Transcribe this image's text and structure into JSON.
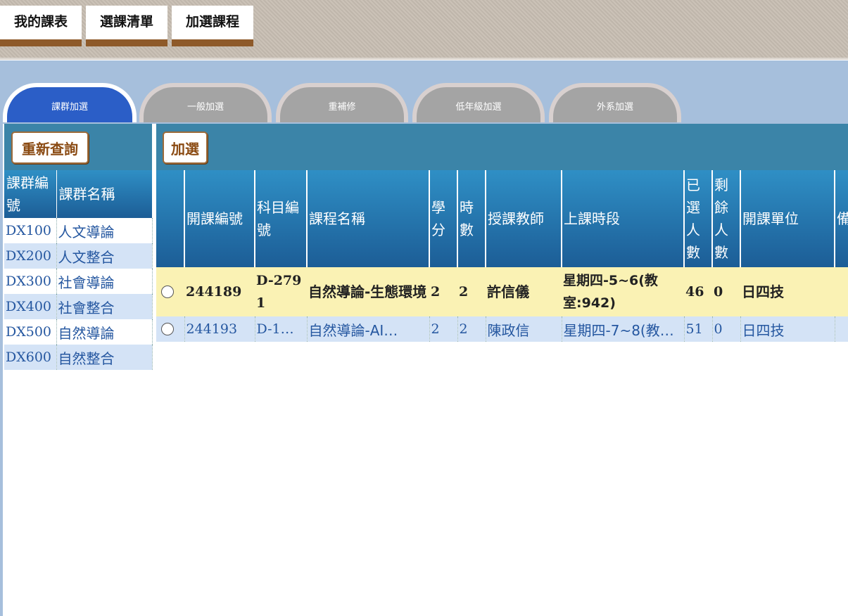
{
  "top_nav": {
    "my_schedule": "我的課表",
    "course_list": "選課清單",
    "add_course": "加選課程"
  },
  "tabs": [
    {
      "label": "課群加選",
      "active": true
    },
    {
      "label": "一般加選",
      "active": false
    },
    {
      "label": "重補修",
      "active": false
    },
    {
      "label": "低年級加選",
      "active": false
    },
    {
      "label": "外系加選",
      "active": false
    }
  ],
  "left_panel": {
    "requery_button": "重新查詢",
    "headers": {
      "group_id": "課群編號",
      "group_name": "課群名稱"
    },
    "groups": [
      {
        "id": "DX100",
        "name": "人文導論"
      },
      {
        "id": "DX200",
        "name": "人文整合"
      },
      {
        "id": "DX300",
        "name": "社會導論"
      },
      {
        "id": "DX400",
        "name": "社會整合"
      },
      {
        "id": "DX500",
        "name": "自然導論"
      },
      {
        "id": "DX600",
        "name": "自然整合"
      }
    ]
  },
  "main_panel": {
    "add_button": "加選",
    "headers": {
      "course_no": "開課編號",
      "subject_no": "科目編號",
      "course_name": "課程名稱",
      "credits": "學分",
      "hours": "時數",
      "teacher": "授課教師",
      "time": "上課時段",
      "enrolled": "已選人數",
      "remaining": "剩餘人數",
      "department": "開課單位",
      "note": "備"
    },
    "rows": [
      {
        "course_no": "244189",
        "subject_no": "D-2791",
        "course_name": "自然導論-生態環境",
        "credits": "2",
        "hours": "2",
        "teacher": "許信儀",
        "time": "星期四-5~6(教室:942)",
        "enrolled": "46",
        "remaining": "0",
        "department": "日四技",
        "highlighted": true
      },
      {
        "course_no": "244193",
        "subject_no": "D-1…",
        "course_name": "自然導論-AI…",
        "credits": "2",
        "hours": "2",
        "teacher": "陳政信",
        "time": "星期四-7~8(教…",
        "enrolled": "51",
        "remaining": "0",
        "department": "日四技",
        "highlighted": false
      }
    ]
  },
  "colors": {
    "header_blue": "#1c5d96",
    "tab_active": "#2b5ec7",
    "tab_inactive": "#a4a4a4",
    "highlight_row": "#faf2b4",
    "alt_row": "#d4e3f6",
    "brown_accent": "#8e5a2a"
  }
}
